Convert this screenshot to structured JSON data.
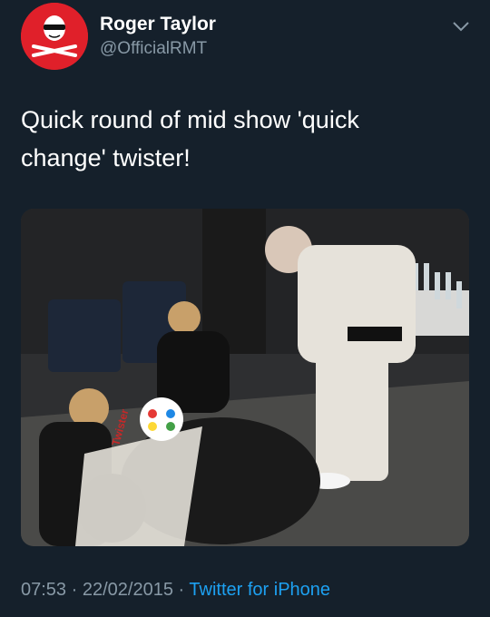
{
  "author": {
    "display_name": "Roger Taylor",
    "handle": "@OfficialRMT"
  },
  "tweet": {
    "text_line1": "Quick round of mid show 'quick",
    "text_line2": "change' twister!"
  },
  "media": {
    "spinner_text": "Twister"
  },
  "meta": {
    "time": "07:53",
    "separator": "·",
    "date": "22/02/2015",
    "source": "Twitter for iPhone"
  },
  "colors": {
    "background": "#15202b",
    "secondary_text": "#8899a6",
    "link": "#1da1f2",
    "avatar_red": "#e0202a"
  },
  "icons": {
    "avatar": "skull-crossbones-logo",
    "menu": "chevron-down-icon"
  }
}
